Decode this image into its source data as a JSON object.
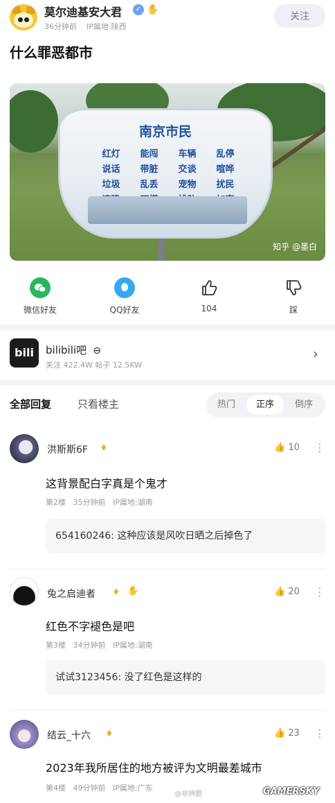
{
  "post": {
    "author": "莫尔迪基安大君",
    "badge_icon": "verified-badge",
    "meta": "36分钟前 · IP属地:陕西",
    "meta_time": "36分钟前",
    "meta_ip": "IP属地:陕西",
    "follow_label": "关注",
    "title": "什么罪恶都市"
  },
  "image": {
    "sign_title": "南京市民",
    "sign_rows": [
      [
        "红灯",
        "能闯",
        "车辆",
        "乱停"
      ],
      [
        "说话",
        "带脏",
        "交谈",
        "喧哗"
      ],
      [
        "垃圾",
        "乱丢",
        "宠物",
        "扰民"
      ],
      [
        "违建",
        "可搭",
        "排队",
        "加塞"
      ]
    ],
    "watermark": "知乎 @墨白"
  },
  "share": {
    "wechat_label": "微信好友",
    "qq_label": "QQ好友",
    "like_count": "104",
    "dislike_label": "踩",
    "colors": {
      "wechat": "#2bb55c",
      "qq": "#35a8f0"
    }
  },
  "forum": {
    "logo_text": "bili",
    "name": "bilibili吧",
    "stats": "关注 422.4W  帖子 12.5KW"
  },
  "tabs": {
    "all": "全部回复",
    "op_only": "只看楼主",
    "sort_hot": "热门",
    "sort_asc": "正序",
    "sort_desc": "倒序",
    "active_sort": "正序"
  },
  "comments": [
    {
      "name": "洪斯斯6F",
      "likes": "10",
      "text": "这背景配白字真是个鬼才",
      "floor": "第2楼",
      "time": "35分钟前",
      "ip": "IP属地:湖南",
      "reply": "654160246:  这种应该是风吹日晒之后掉色了"
    },
    {
      "name": "兔之启迪者",
      "likes": "20",
      "text": "红色不字褪色是吧",
      "floor": "第3楼",
      "time": "34分钟前",
      "ip": "IP属地:湖南",
      "reply": "试试3123456:  没了红色是这样的"
    },
    {
      "name": "结云_十六",
      "likes": "23",
      "text": "2023年我所居住的地方被评为文明最差城市",
      "floor": "第4楼",
      "time": "49分钟前",
      "ip": "IP属地:广东"
    }
  ],
  "watermarks": {
    "gamersky": "GAMERSKY",
    "weibo": "@非辨题"
  }
}
